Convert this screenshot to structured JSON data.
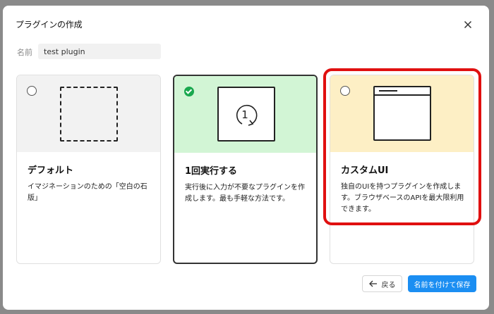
{
  "dialog": {
    "title": "プラグインの作成",
    "close_icon": "close-icon"
  },
  "name": {
    "label": "名前",
    "value": "test plugin"
  },
  "cards": [
    {
      "title": "デフォルト",
      "description": "イマジネーションのための「空白の石版」",
      "selected": false,
      "accent": "#f2f2f2",
      "icon": "dashed-square-icon"
    },
    {
      "title": "1回実行する",
      "description": "実行後に入力が不要なプラグインを作成します。最も手軽な方法です。",
      "selected": true,
      "accent": "#d2f5d5",
      "icon": "run-once-icon",
      "icon_text": "1"
    },
    {
      "title": "カスタムUI",
      "description": "独自のUIを持つプラグインを作成します。ブラウザベースのAPIを最大限利用できます。",
      "selected": false,
      "accent": "#fdefc5",
      "icon": "window-ui-icon",
      "highlighted": true,
      "highlight_color": "#e01010"
    }
  ],
  "footer": {
    "back_label": "戻る",
    "save_label": "名前を付けて保存",
    "save_color": "#1b8ef2"
  }
}
